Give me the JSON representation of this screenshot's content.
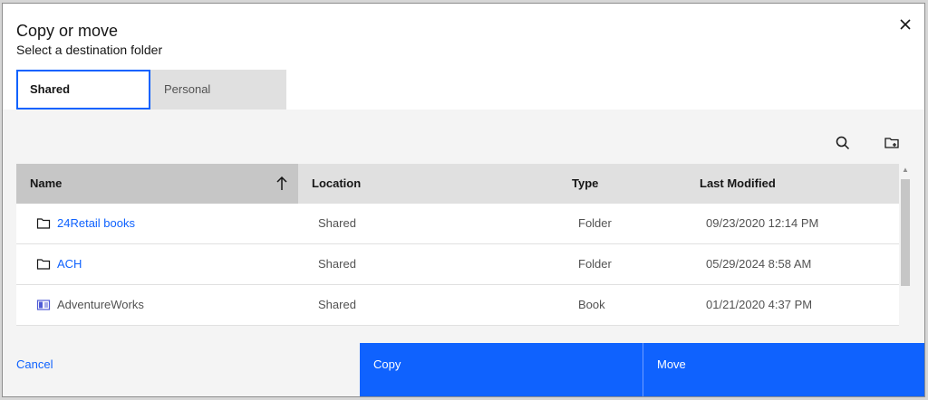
{
  "dialog": {
    "title": "Copy or move",
    "subtitle": "Select a destination folder",
    "close_icon": "close-icon"
  },
  "tabs": [
    {
      "label": "Shared",
      "selected": true
    },
    {
      "label": "Personal",
      "selected": false
    }
  ],
  "toolbar": {
    "search_icon": "search-icon",
    "new_folder_icon": "new-folder-icon"
  },
  "table": {
    "columns": [
      "Name",
      "Location",
      "Type",
      "Last Modified"
    ],
    "sort_column": "Name",
    "sort_direction": "ascending",
    "rows": [
      {
        "name": "24Retail books",
        "location": "Shared",
        "type": "Folder",
        "modified": "09/23/2020 12:14 PM",
        "icon": "folder-icon"
      },
      {
        "name": "ACH",
        "location": "Shared",
        "type": "Folder",
        "modified": "05/29/2024 8:58 AM",
        "icon": "folder-icon"
      },
      {
        "name": "AdventureWorks",
        "location": "Shared",
        "type": "Book",
        "modified": "01/21/2020 4:37 PM",
        "icon": "book-icon"
      }
    ]
  },
  "footer": {
    "cancel_label": "Cancel",
    "copy_label": "Copy",
    "move_label": "Move"
  },
  "colors": {
    "accent": "#0f62fe",
    "header_bg": "#e0e0e0",
    "panel_bg": "#f4f4f4"
  }
}
